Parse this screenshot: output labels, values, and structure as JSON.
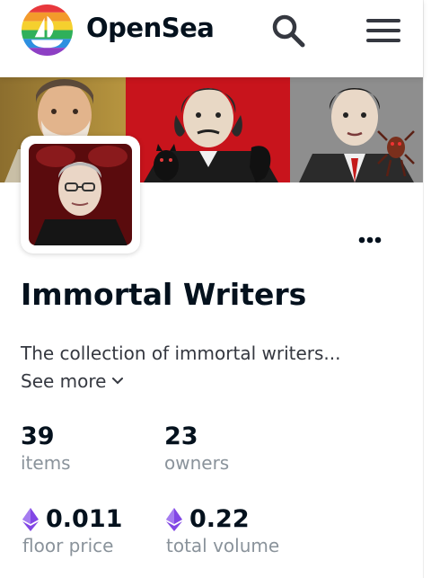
{
  "brand": {
    "name": "OpenSea"
  },
  "collection": {
    "title": "Immortal Writers",
    "description": "The collection of immortal writers...",
    "see_more": "See more"
  },
  "stats": {
    "items": {
      "value": "39",
      "label": "items"
    },
    "owners": {
      "value": "23",
      "label": "owners"
    },
    "floor": {
      "value": "0.011",
      "label": "floor price"
    },
    "volume": {
      "value": "0.22",
      "label": "total volume"
    }
  },
  "icons": {
    "logo": "opensea-rainbow-logo-icon",
    "search": "search-icon",
    "menu": "hamburger-menu-icon",
    "more": "more-dots-icon",
    "chevron": "chevron-down-icon",
    "eth": "ethereum-icon"
  },
  "colors": {
    "text": "#04111d",
    "muted": "#8a939b",
    "eth": "#8247e5"
  }
}
